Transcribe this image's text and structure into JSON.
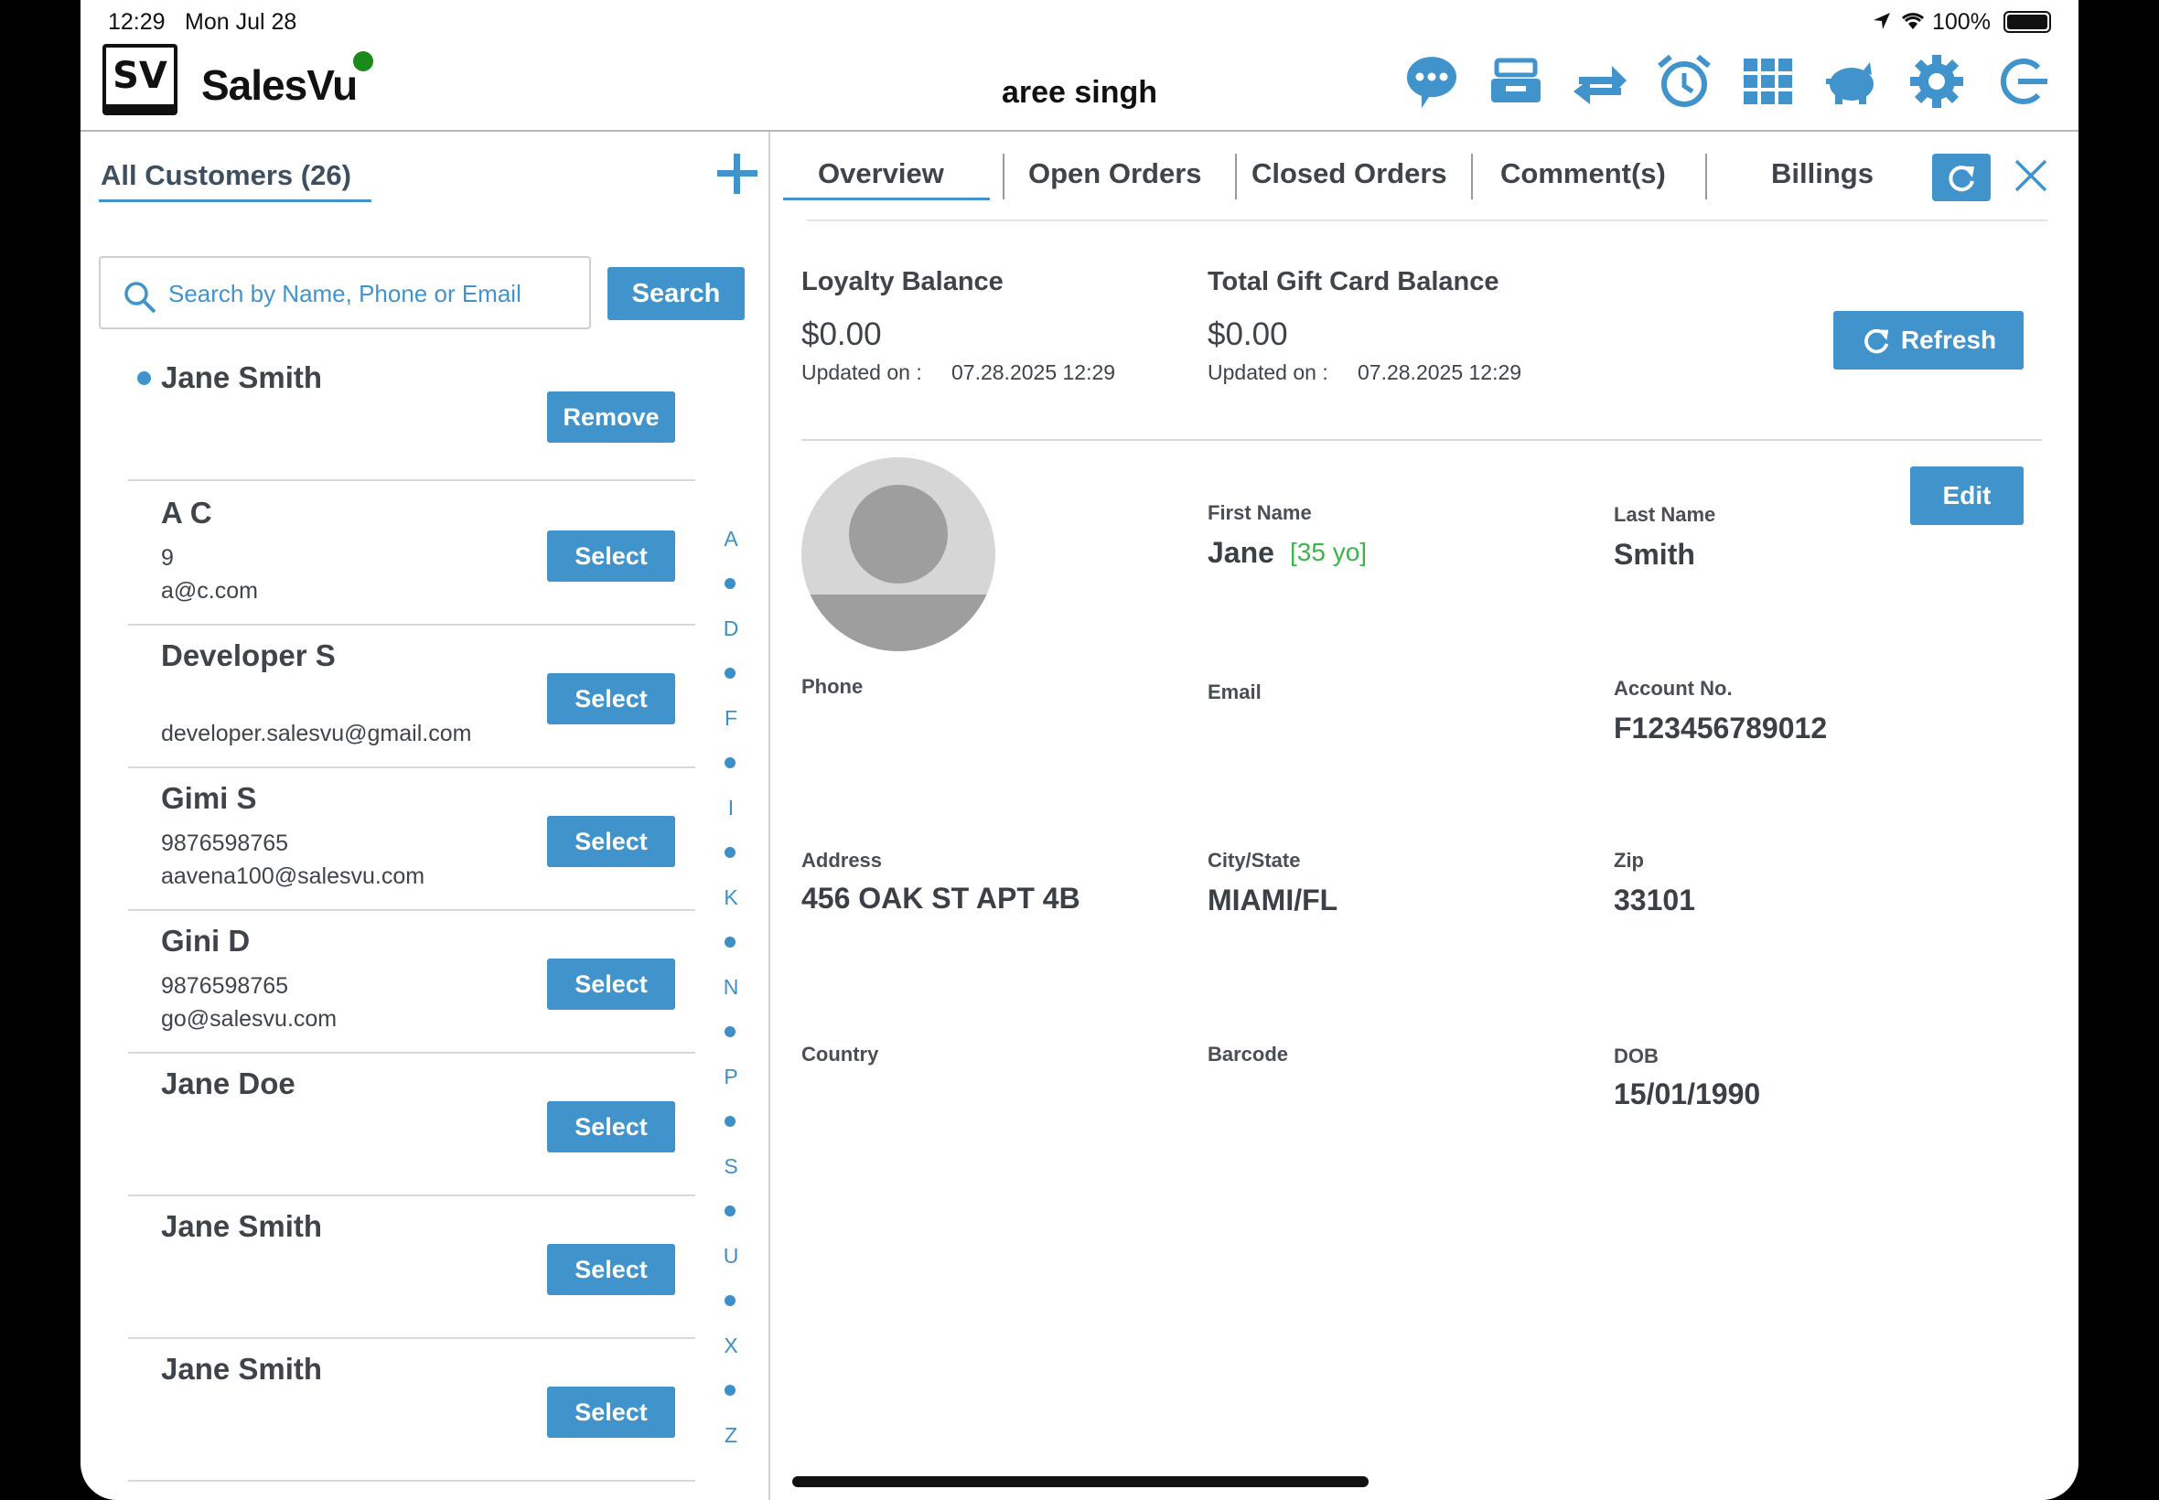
{
  "status_bar": {
    "time": "12:29",
    "date": "Mon Jul 28",
    "battery": "100%"
  },
  "header": {
    "logo_text": "SV",
    "brand": "SalesVu",
    "user_name": "aree singh",
    "icons": [
      "chat-icon",
      "drawer-icon",
      "transfer-icon",
      "alarm-icon",
      "grid-icon",
      "piggy-bank-icon",
      "gear-icon",
      "logout-icon"
    ]
  },
  "customers": {
    "title": "All Customers (26)",
    "search_placeholder": "Search by Name, Phone or Email",
    "search_label": "Search",
    "selected": {
      "name": "Jane Smith",
      "button": "Remove"
    },
    "items": [
      {
        "name": "A C",
        "phone": "9",
        "email": "a@c.com",
        "button": "Select"
      },
      {
        "name": "Developer S",
        "phone": "",
        "email": "developer.salesvu@gmail.com",
        "button": "Select"
      },
      {
        "name": "Gimi S",
        "phone": "9876598765",
        "email": "aavena100@salesvu.com",
        "button": "Select"
      },
      {
        "name": "Gini D",
        "phone": "9876598765",
        "email": "go@salesvu.com",
        "button": "Select"
      },
      {
        "name": "Jane Doe",
        "phone": "",
        "email": "",
        "button": "Select"
      },
      {
        "name": "Jane Smith",
        "phone": "",
        "email": "",
        "button": "Select"
      },
      {
        "name": "Jane Smith",
        "phone": "",
        "email": "",
        "button": "Select"
      }
    ],
    "index_letters": [
      "A",
      "D",
      "F",
      "I",
      "K",
      "N",
      "P",
      "S",
      "U",
      "X",
      "Z"
    ]
  },
  "tabs": [
    "Overview",
    "Open Orders",
    "Closed Orders",
    "Comment(s)",
    "Billings"
  ],
  "balances": {
    "loyalty_label": "Loyalty Balance",
    "loyalty_value": "$0.00",
    "loyalty_updated_label": "Updated on :",
    "loyalty_updated": "07.28.2025 12:29",
    "gift_label": "Total Gift Card Balance",
    "gift_value": "$0.00",
    "gift_updated_label": "Updated on :",
    "gift_updated": "07.28.2025 12:29",
    "refresh_label": "Refresh"
  },
  "profile": {
    "edit_label": "Edit",
    "first_name_label": "First Name",
    "first_name": "Jane",
    "age": "[35 yo]",
    "last_name_label": "Last Name",
    "last_name": "Smith",
    "phone_label": "Phone",
    "phone": "",
    "email_label": "Email",
    "email": "",
    "account_label": "Account No.",
    "account": "F123456789012",
    "address_label": "Address",
    "address": "456 OAK ST APT 4B",
    "city_label": "City/State",
    "city": "MIAMI/FL",
    "zip_label": "Zip",
    "zip": "33101",
    "country_label": "Country",
    "country": "",
    "barcode_label": "Barcode",
    "barcode": "",
    "dob_label": "DOB",
    "dob": "15/01/1990"
  },
  "colors": {
    "accent": "#4193cc",
    "age": "#3cb54a",
    "online": "#1a8a1a"
  }
}
